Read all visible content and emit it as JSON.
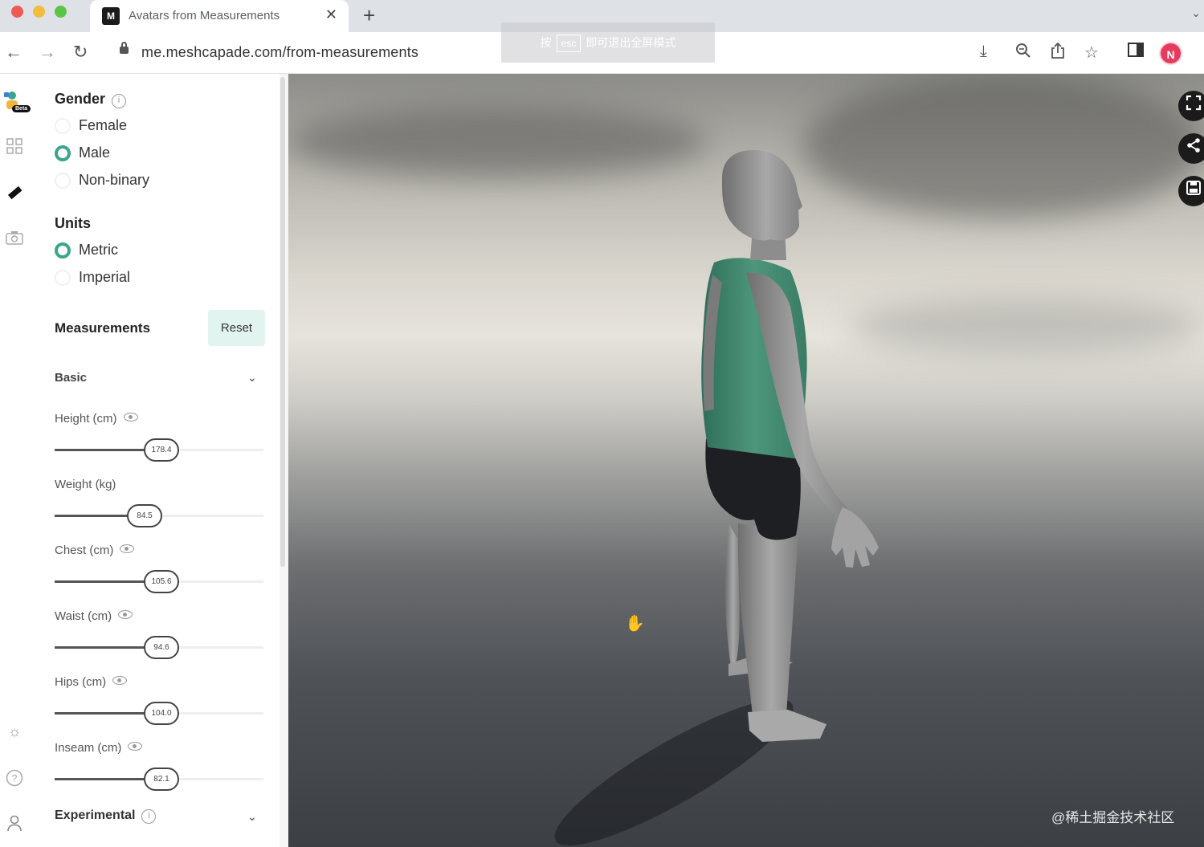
{
  "browser": {
    "tab_title": "Avatars from Measurements",
    "tab_close": "✕",
    "new_tab": "+",
    "url": "me.meshcapade.com/from-measurements",
    "fullscreen_hint": {
      "prefix": "按",
      "key": "esc",
      "suffix": "即可退出全屏模式"
    },
    "profile_initial": "N",
    "icons": [
      "back-arrow-icon",
      "forward-arrow-icon",
      "reload-icon",
      "lock-icon",
      "download-icon",
      "zoom-icon",
      "share-icon",
      "star-icon",
      "sidebar-icon",
      "profile-avatar"
    ]
  },
  "app": {
    "logo_badge": "Beta",
    "rail_icons": [
      "grid-icon",
      "ruler-icon",
      "camera-icon",
      "sun-icon",
      "help-icon",
      "user-icon"
    ]
  },
  "gender": {
    "title": "Gender",
    "options": [
      {
        "label": "Female",
        "selected": false
      },
      {
        "label": "Male",
        "selected": true
      },
      {
        "label": "Non-binary",
        "selected": false
      }
    ]
  },
  "units": {
    "title": "Units",
    "options": [
      {
        "label": "Metric",
        "selected": true
      },
      {
        "label": "Imperial",
        "selected": false
      }
    ]
  },
  "measurements": {
    "title": "Measurements",
    "reset_label": "Reset",
    "group_label": "Basic",
    "items": [
      {
        "label": "Height (cm)",
        "value": "178.4",
        "fraction": 0.51
      },
      {
        "label": "Weight (kg)",
        "value": "84.5",
        "fraction": 0.43
      },
      {
        "label": "Chest (cm)",
        "value": "105.6",
        "fraction": 0.51
      },
      {
        "label": "Waist (cm)",
        "value": "94.6",
        "fraction": 0.51
      },
      {
        "label": "Hips (cm)",
        "value": "104.0",
        "fraction": 0.51
      },
      {
        "label": "Inseam (cm)",
        "value": "82.1",
        "fraction": 0.51
      }
    ],
    "experimental_label": "Experimental"
  },
  "viewport": {
    "buttons": [
      "fullscreen-icon",
      "share-icon",
      "save-icon"
    ],
    "watermark": "@稀土掘金技术社区",
    "colors": {
      "accent": "#3aa68b",
      "tank_top": "#3f8c72",
      "shorts": "#1e1f22",
      "skin": "#9c9c9c"
    }
  }
}
